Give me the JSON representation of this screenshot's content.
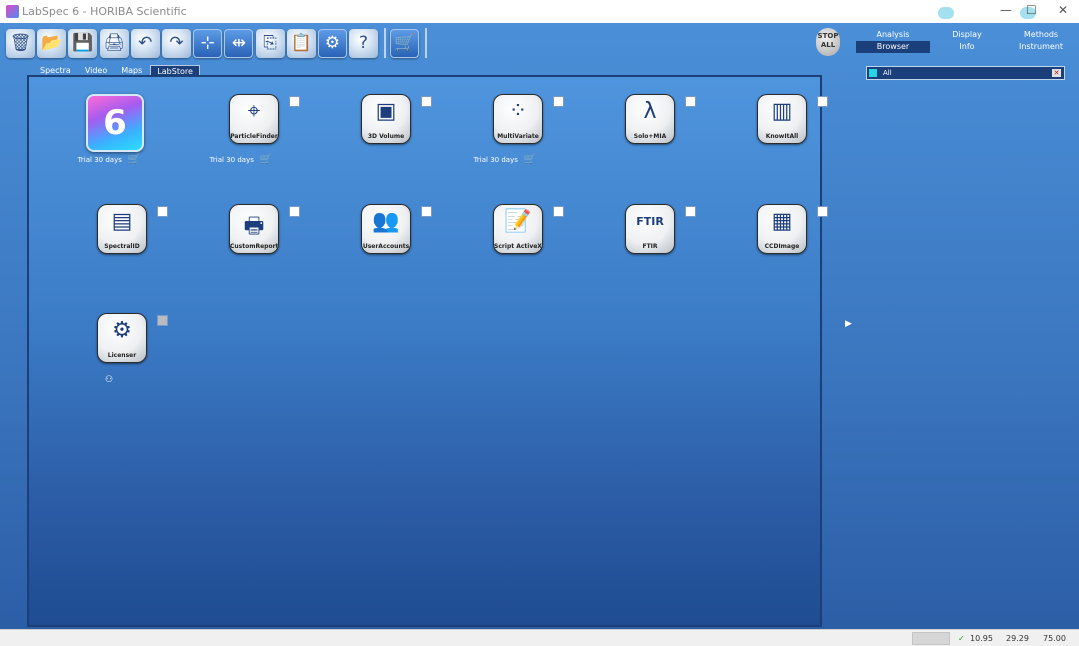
{
  "window": {
    "title": "LabSpec 6 - HORIBA Scientific",
    "minimize": "—",
    "maximize": "☐",
    "close": "✕"
  },
  "toolbar": {
    "buttons": [
      {
        "name": "trash-button",
        "icon": "🗑"
      },
      {
        "name": "open-button",
        "icon": "📂"
      },
      {
        "name": "save-button",
        "icon": "💾"
      },
      {
        "name": "print-button",
        "icon": "🖨"
      },
      {
        "name": "undo-button",
        "icon": "↶"
      },
      {
        "name": "redo-button",
        "icon": "↷"
      },
      {
        "name": "cursor-h-button",
        "icon": "⊹"
      },
      {
        "name": "cursor-v-button",
        "icon": "⇹"
      },
      {
        "name": "copy-button",
        "icon": "⎘"
      },
      {
        "name": "paste-button",
        "icon": "📋"
      },
      {
        "name": "settings-button",
        "icon": "⚙"
      },
      {
        "name": "help-button",
        "icon": "?"
      }
    ],
    "cart_icon": "🛒",
    "stop_all": "STOP ALL"
  },
  "subtabs": [
    "Spectra",
    "Video",
    "Maps",
    "LabStore"
  ],
  "subtab_active": "LabStore",
  "right_tabs": {
    "row1": [
      "Analysis",
      "Display",
      "Methods"
    ],
    "row2": [
      "Browser",
      "Info",
      "Instrument"
    ],
    "active": "Browser"
  },
  "right_panel": {
    "label": "All"
  },
  "items": [
    {
      "name": "labspec6",
      "caption": "",
      "trial": "Trial 30 days",
      "big": true,
      "glyph": "6"
    },
    {
      "name": "particle-finder",
      "caption": "ParticleFinder",
      "trial": "Trial 30 days",
      "glyph": "⌖"
    },
    {
      "name": "3d-volume",
      "caption": "3D Volume",
      "trial": "",
      "glyph": "▣"
    },
    {
      "name": "multivariate",
      "caption": "MultiVariate",
      "trial": "Trial 30 days",
      "glyph": "⁘"
    },
    {
      "name": "solo-mia",
      "caption": "Solo+MIA",
      "trial": "",
      "glyph": "λ"
    },
    {
      "name": "know-it-all",
      "caption": "KnowItAll",
      "trial": "",
      "glyph": "▥"
    },
    {
      "name": "spectral-id",
      "caption": "SpectralID",
      "trial": "",
      "glyph": "▤"
    },
    {
      "name": "custom-report",
      "caption": "CustomReport",
      "trial": "",
      "glyph": "🖶"
    },
    {
      "name": "user-accounts",
      "caption": "UserAccounts",
      "trial": "",
      "glyph": "👥"
    },
    {
      "name": "script-activex",
      "caption": "Script ActiveX",
      "trial": "",
      "glyph": "📝"
    },
    {
      "name": "ftir",
      "caption": "FTIR",
      "trial": "",
      "glyph": "FTIR"
    },
    {
      "name": "ccd-image",
      "caption": "CCDImage",
      "trial": "",
      "glyph": "▦"
    },
    {
      "name": "licenser",
      "caption": "Licenser",
      "trial": "",
      "glyph": "⚙"
    }
  ],
  "status": {
    "check": "✓",
    "v1": "10.95",
    "v2": "29.29",
    "v3": "75.00"
  }
}
